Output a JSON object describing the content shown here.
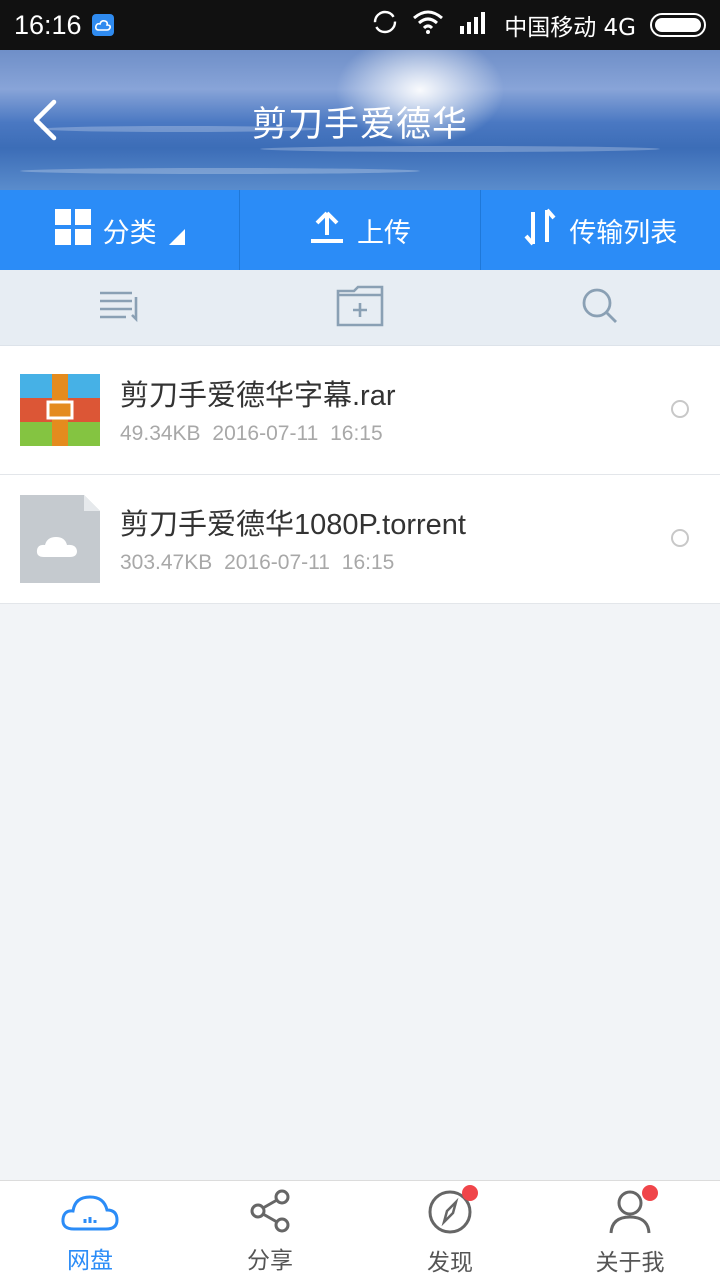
{
  "status_bar": {
    "time": "16:16",
    "carrier": "中国移动 4G",
    "icons": [
      "cloud-app-icon",
      "sync-icon",
      "wifi-icon",
      "signal-icon",
      "battery-icon"
    ]
  },
  "header": {
    "title": "剪刀手爱德华",
    "back_icon": "back-arrow-icon"
  },
  "actions": [
    {
      "label": "分类",
      "icon": "grid-icon"
    },
    {
      "label": "上传",
      "icon": "upload-icon"
    },
    {
      "label": "传输列表",
      "icon": "transfer-icon"
    }
  ],
  "toolbar": {
    "icons": [
      "sort-list-icon",
      "new-folder-icon",
      "search-icon"
    ]
  },
  "files": [
    {
      "name": "剪刀手爱德华字幕.rar",
      "meta": "49.34KB  2016-07-11  16:15",
      "icon": "rar-archive-icon"
    },
    {
      "name": "剪刀手爱德华1080P.torrent",
      "meta": "303.47KB  2016-07-11  16:15",
      "icon": "torrent-file-icon"
    }
  ],
  "bottom_nav": [
    {
      "label": "网盘",
      "icon": "cloud-disk-icon",
      "active": true
    },
    {
      "label": "分享",
      "icon": "share-icon",
      "active": false
    },
    {
      "label": "发现",
      "icon": "compass-icon",
      "active": false,
      "badge": true
    },
    {
      "label": "关于我",
      "icon": "user-icon",
      "active": false,
      "badge": true
    }
  ],
  "colors": {
    "accent": "#2b8cf7",
    "badge": "#f0454a"
  }
}
